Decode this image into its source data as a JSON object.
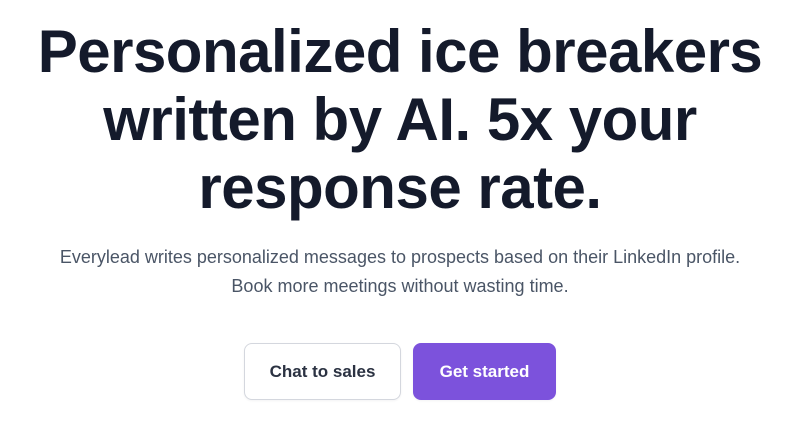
{
  "hero": {
    "headline_lines": [
      "Personalized ice breakers",
      "written by AI. 5x your",
      "response rate."
    ],
    "subtitle_lines": [
      "Everylead writes personalized messages to prospects based on their LinkedIn profile.",
      "Book more meetings without wasting time."
    ]
  },
  "actions": {
    "secondary_label": "Chat to sales",
    "primary_label": "Get started"
  },
  "colors": {
    "heading": "#141a2b",
    "body_text": "#4a5566",
    "primary": "#7c52dc",
    "secondary_border": "#d4d7de"
  }
}
